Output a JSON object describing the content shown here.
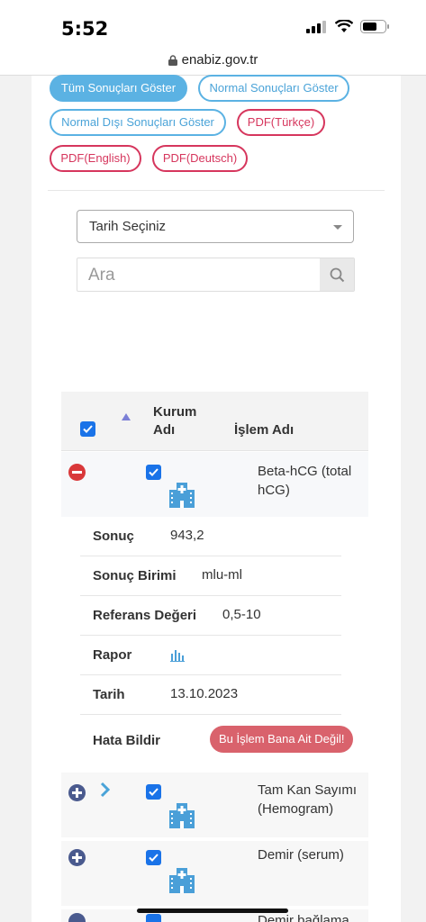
{
  "status_bar": {
    "time": "5:52"
  },
  "browser": {
    "url": "enabiz.gov.tr"
  },
  "filters": {
    "all": "Tüm Sonuçları Göster",
    "normal": "Normal Sonuçları Göster",
    "abnormal": "Normal Dışı Sonuçları Göster",
    "pdf_tr": "PDF(Türkçe)",
    "pdf_en": "PDF(English)",
    "pdf_de": "PDF(Deutsch)"
  },
  "date_select": {
    "value": "Tarih Seçiniz"
  },
  "search": {
    "placeholder": "Ara"
  },
  "table": {
    "headers": {
      "institution": "Kurum Adı",
      "institution_l1": "Kurum",
      "institution_l2": "Adı",
      "procedure": "İşlem Adı"
    },
    "rows": [
      {
        "name_l1": "Beta-hCG (total",
        "name_l2": "hCG)",
        "expanded": true
      },
      {
        "name_l1": "Tam Kan Sayımı",
        "name_l2": "(Hemogram)",
        "expanded": false
      },
      {
        "name_l1": "Demir (serum)",
        "name_l2": "",
        "expanded": false
      },
      {
        "name_l1": "Demir bağlama",
        "name_l2": "",
        "expanded": false
      }
    ]
  },
  "detail": {
    "result_label": "Sonuç",
    "result_value": "943,2",
    "unit_label": "Sonuç Birimi",
    "unit_value": "mlu-ml",
    "ref_label": "Referans Değeri",
    "ref_value": "0,5-10",
    "report_label": "Rapor",
    "date_label": "Tarih",
    "date_value": "13.10.2023",
    "error_label": "Hata Bildir",
    "error_button": "Bu İşlem Bana Ait Değil!"
  },
  "colors": {
    "accent_blue": "#5bb2e3",
    "pdf_red": "#d6365d",
    "checkbox": "#1a73e8",
    "building": "#4a9fd8"
  }
}
